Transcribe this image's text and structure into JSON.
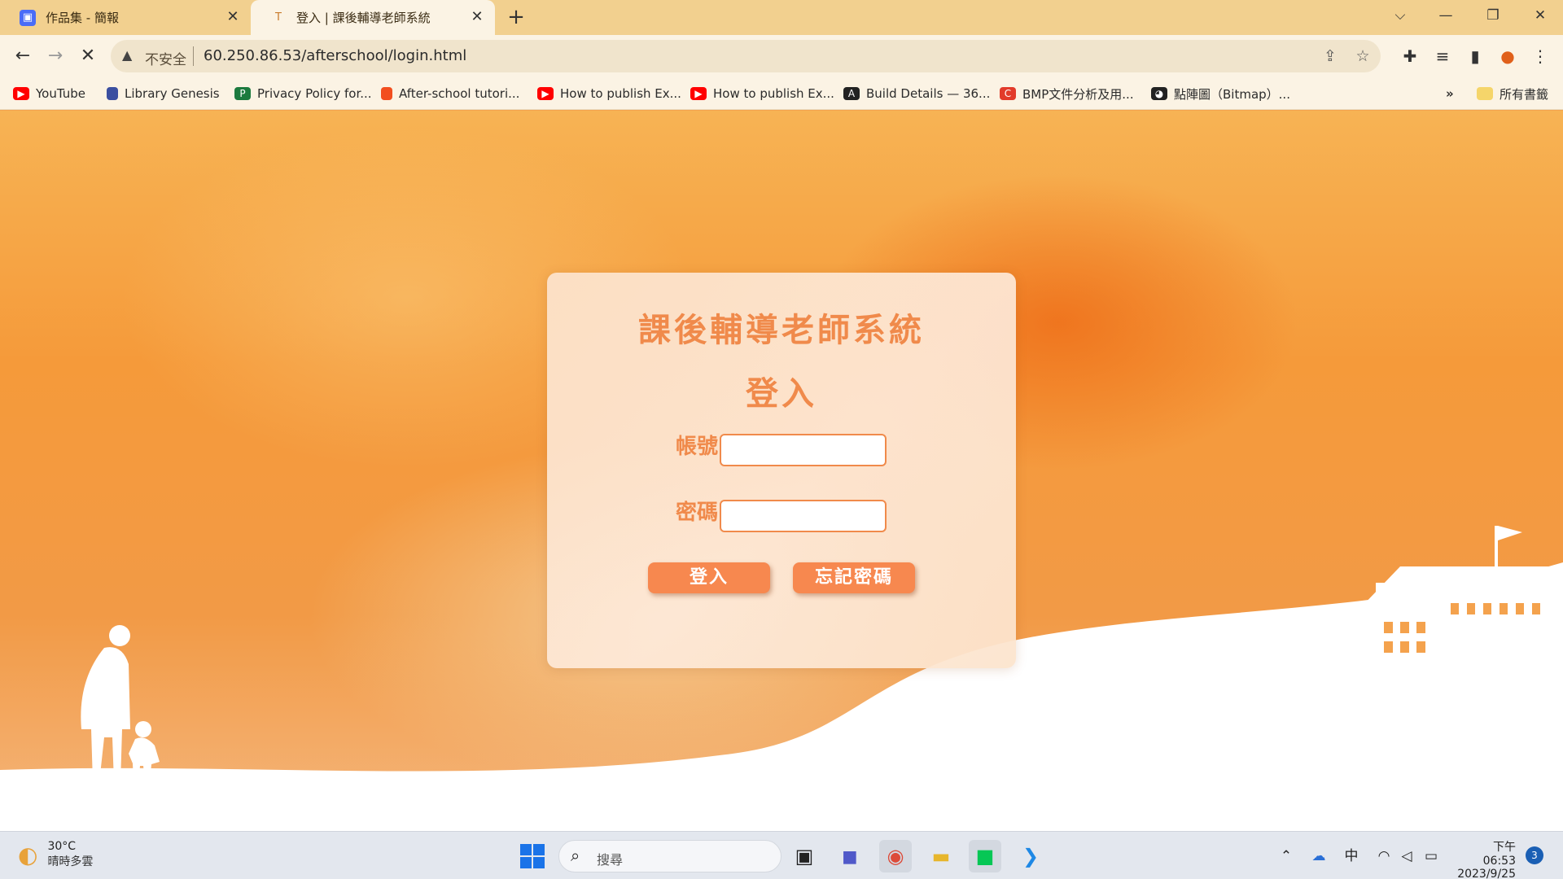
{
  "browser": {
    "tabs": [
      {
        "title": "作品集 - 簡報",
        "icon": "slides-app-icon"
      },
      {
        "title": "登入 | 課後輔導老師系統",
        "icon": "site-favicon-icon",
        "active": true
      }
    ],
    "address": {
      "security_label": "不安全",
      "url": "60.250.86.53/afterschool/login.html"
    },
    "bookmarks": [
      {
        "label": "YouTube",
        "icon": "youtube-icon",
        "color": "#ff0000"
      },
      {
        "label": "Library Genesis",
        "icon": "library-genesis-icon",
        "color": "#3b4fa0"
      },
      {
        "label": "Privacy Policy for...",
        "icon": "privacy-policy-icon",
        "color": "#1c7a3e"
      },
      {
        "label": "After-school tutori...",
        "icon": "figma-icon",
        "color": "#f24e1e"
      },
      {
        "label": "How to publish Ex...",
        "icon": "youtube-icon",
        "color": "#ff0000"
      },
      {
        "label": "How to publish Ex...",
        "icon": "youtube-icon",
        "color": "#ff0000"
      },
      {
        "label": "Build Details — 36...",
        "icon": "build-icon",
        "color": "#222222"
      },
      {
        "label": "BMP文件分析及用...",
        "icon": "csdn-icon",
        "color": "#e23b2a"
      },
      {
        "label": "點陣圖（Bitmap）...",
        "icon": "cat-icon",
        "color": "#222222"
      }
    ],
    "all_bookmarks_label": "所有書籤",
    "more_bookmarks": "»"
  },
  "page": {
    "system_title": "課後輔導老師系統",
    "login_heading": "登入",
    "account_label": "帳號",
    "password_label": "密碼",
    "account_value": "",
    "password_value": "",
    "login_button": "登入",
    "forgot_button": "忘記密碼",
    "accent_color": "#f08a4b"
  },
  "taskbar": {
    "weather_temp": "30°C",
    "weather_desc": "晴時多雲",
    "search_placeholder": "搜尋",
    "ime_label": "中",
    "time": "下午 06:53",
    "date": "2023/9/25",
    "notification_count": "3"
  }
}
